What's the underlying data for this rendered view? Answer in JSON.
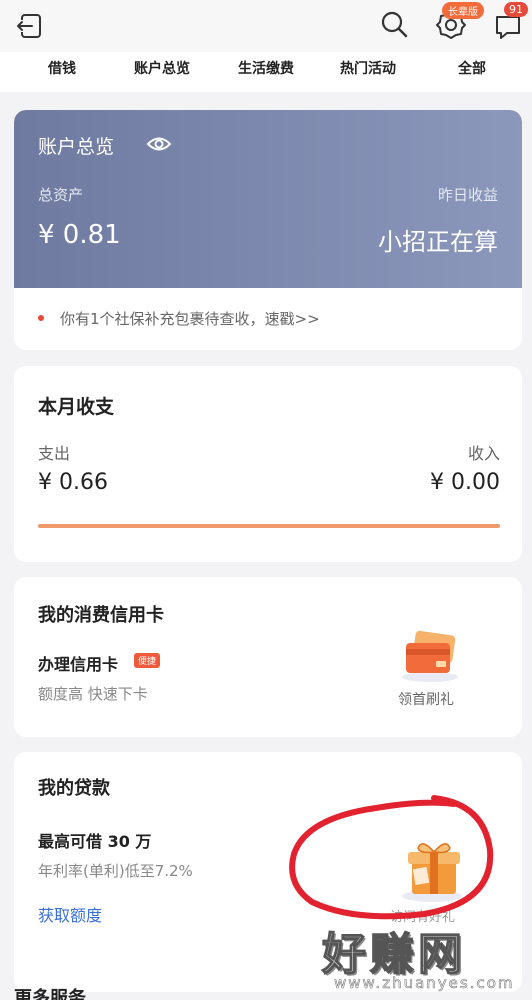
{
  "header": {
    "elder_badge": "长辈版",
    "message_count": "91"
  },
  "nav": {
    "items": [
      "借钱",
      "账户总览",
      "生活缴费",
      "热门活动",
      "全部"
    ]
  },
  "account": {
    "title": "账户总览",
    "total_label": "总资产",
    "total_value": "¥ 0.81",
    "yesterday_label": "昨日收益",
    "yesterday_value": "小招正在算",
    "notice": "你有1个社保补充包裹待查收，速戳>>"
  },
  "month": {
    "title": "本月收支",
    "expense_label": "支出",
    "expense_value": "¥ 0.66",
    "income_label": "收入",
    "income_value": "¥ 0.00",
    "progress": 1.0
  },
  "credit": {
    "title": "我的消费信用卡",
    "apply_label": "办理信用卡",
    "apply_badge": "便捷",
    "desc": "额度高 快速下卡",
    "promo": "领首刷礼"
  },
  "loan": {
    "title": "我的贷款",
    "max_label": "最高可借 30 万",
    "rate": "年利率(单利)低至7.2%",
    "link": "获取额度",
    "promo": "访问有好礼"
  },
  "more": {
    "title": "更多服务"
  },
  "watermark": {
    "main": "好赚网",
    "sub": "www.zhuanyes.com"
  },
  "colors": {
    "accent_orange": "#f26b3a",
    "card_blue": "#7a85aa",
    "link_blue": "#3b6fd8",
    "progress": "#ee9a6a"
  }
}
